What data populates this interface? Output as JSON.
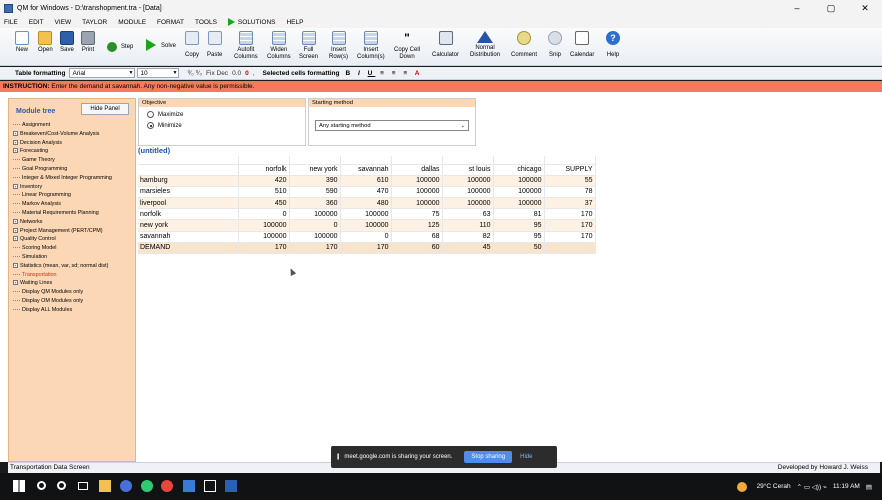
{
  "window": {
    "title": "QM for Windows - D:\\transhopment.tra - [Data]",
    "controls": [
      "–",
      "▢",
      "✕"
    ]
  },
  "menu": [
    "FILE",
    "EDIT",
    "VIEW",
    "TAYLOR",
    "MODULE",
    "FORMAT",
    "TOOLS",
    "SOLUTIONS",
    "HELP"
  ],
  "toolbar": {
    "new": "New",
    "open": "Open",
    "save": "Save",
    "print": "Print",
    "step": "Step",
    "solve": "Solve",
    "copy": "Copy",
    "paste": "Paste",
    "autofit": "Autofit\nColumns",
    "widen": "Widen\nColumns",
    "full": "Full\nScreen",
    "insert_rows": "Insert\nRow(s)",
    "insert_cols": "Insert\nColumn(s)",
    "copy_cell": "Copy Cell\nDown",
    "calculator": "Calculator",
    "normal": "Normal\nDistribution",
    "comment": "Comment",
    "snip": "Snip",
    "calendar": "Calendar",
    "help": "Help"
  },
  "format_bar": {
    "label": "Table formatting",
    "font": "Arial",
    "size": "10",
    "fixdec_label": "Fix Dec",
    "fixdec_value": "0.0",
    "selected_label": "Selected cells formatting"
  },
  "instruction": {
    "label": "INSTRUCTION:",
    "text": "Enter the demand at savannah. Any non-negative value is permissible."
  },
  "sidebar": {
    "title": "Module tree",
    "hide_button": "Hide Panel",
    "items": [
      {
        "label": "Assignment",
        "expander": false,
        "active": false
      },
      {
        "label": "Breakeven/Cost-Volume Analysis",
        "expander": true,
        "active": false
      },
      {
        "label": "Decision Analysis",
        "expander": true,
        "active": false
      },
      {
        "label": "Forecasting",
        "expander": true,
        "active": false
      },
      {
        "label": "Game Theory",
        "expander": false,
        "active": false
      },
      {
        "label": "Goal Programming",
        "expander": false,
        "active": false
      },
      {
        "label": "Integer & Mixed Integer Programming",
        "expander": false,
        "active": false
      },
      {
        "label": "Inventory",
        "expander": true,
        "active": false
      },
      {
        "label": "Linear Programming",
        "expander": false,
        "active": false
      },
      {
        "label": "Markov Analysis",
        "expander": false,
        "active": false
      },
      {
        "label": "Material Requirements Planning",
        "expander": false,
        "active": false
      },
      {
        "label": "Networks",
        "expander": true,
        "active": false
      },
      {
        "label": "Project Management (PERT/CPM)",
        "expander": true,
        "active": false
      },
      {
        "label": "Quality Control",
        "expander": true,
        "active": false
      },
      {
        "label": "Scoring Model",
        "expander": false,
        "active": false
      },
      {
        "label": "Simulation",
        "expander": false,
        "active": false
      },
      {
        "label": "Statistics (mean, var, sd; normal dist)",
        "expander": true,
        "active": false
      },
      {
        "label": "Transportation",
        "expander": false,
        "active": true
      },
      {
        "label": "Waiting Lines",
        "expander": true,
        "active": false
      },
      {
        "label": "Display QM Modules only",
        "expander": false,
        "active": false
      },
      {
        "label": "Display OM Modules only",
        "expander": false,
        "active": false
      },
      {
        "label": "Display ALL Modules",
        "expander": false,
        "active": false
      }
    ]
  },
  "objective": {
    "header": "Objective",
    "options": [
      "Maximize",
      "Minimize"
    ],
    "selected": "Minimize"
  },
  "starting_method": {
    "header": "Starting method",
    "value": "Any starting method"
  },
  "data": {
    "title": "(untitled)",
    "columns": [
      "norfolk",
      "new york",
      "savannah",
      "dallas",
      "st louis",
      "chicago",
      "SUPPLY"
    ],
    "rows": [
      {
        "label": "hamburg",
        "values": [
          "420",
          "390",
          "610",
          "100000",
          "100000",
          "100000",
          "55"
        ]
      },
      {
        "label": "marsieles",
        "values": [
          "510",
          "590",
          "470",
          "100000",
          "100000",
          "100000",
          "78"
        ]
      },
      {
        "label": "liverpool",
        "values": [
          "450",
          "360",
          "480",
          "100000",
          "100000",
          "100000",
          "37"
        ]
      },
      {
        "label": "norfolk",
        "values": [
          "0",
          "100000",
          "100000",
          "75",
          "63",
          "81",
          "170"
        ]
      },
      {
        "label": "new york",
        "values": [
          "100000",
          "0",
          "100000",
          "125",
          "110",
          "95",
          "170"
        ]
      },
      {
        "label": "savannah",
        "values": [
          "100000",
          "100000",
          "0",
          "68",
          "82",
          "95",
          "170"
        ]
      },
      {
        "label": "DEMAND",
        "values": [
          "170",
          "170",
          "170",
          "60",
          "45",
          "50",
          ""
        ]
      }
    ]
  },
  "status": {
    "left": "Transportation  Data Screen",
    "right": "Developed by Howard J. Weiss"
  },
  "share_bar": {
    "pause": "||",
    "text": "meet.google.com is sharing your screen.",
    "stop": "Stop sharing",
    "hide": "Hide"
  },
  "taskbar": {
    "weather": "29°C  Cerah",
    "time": "11:19 AM"
  },
  "colors": {
    "instruction_bg": "#f37a5c",
    "sidebar_bg": "#fbd7b5",
    "active_module": "#e02b1b",
    "title_blue": "#2050a8"
  }
}
